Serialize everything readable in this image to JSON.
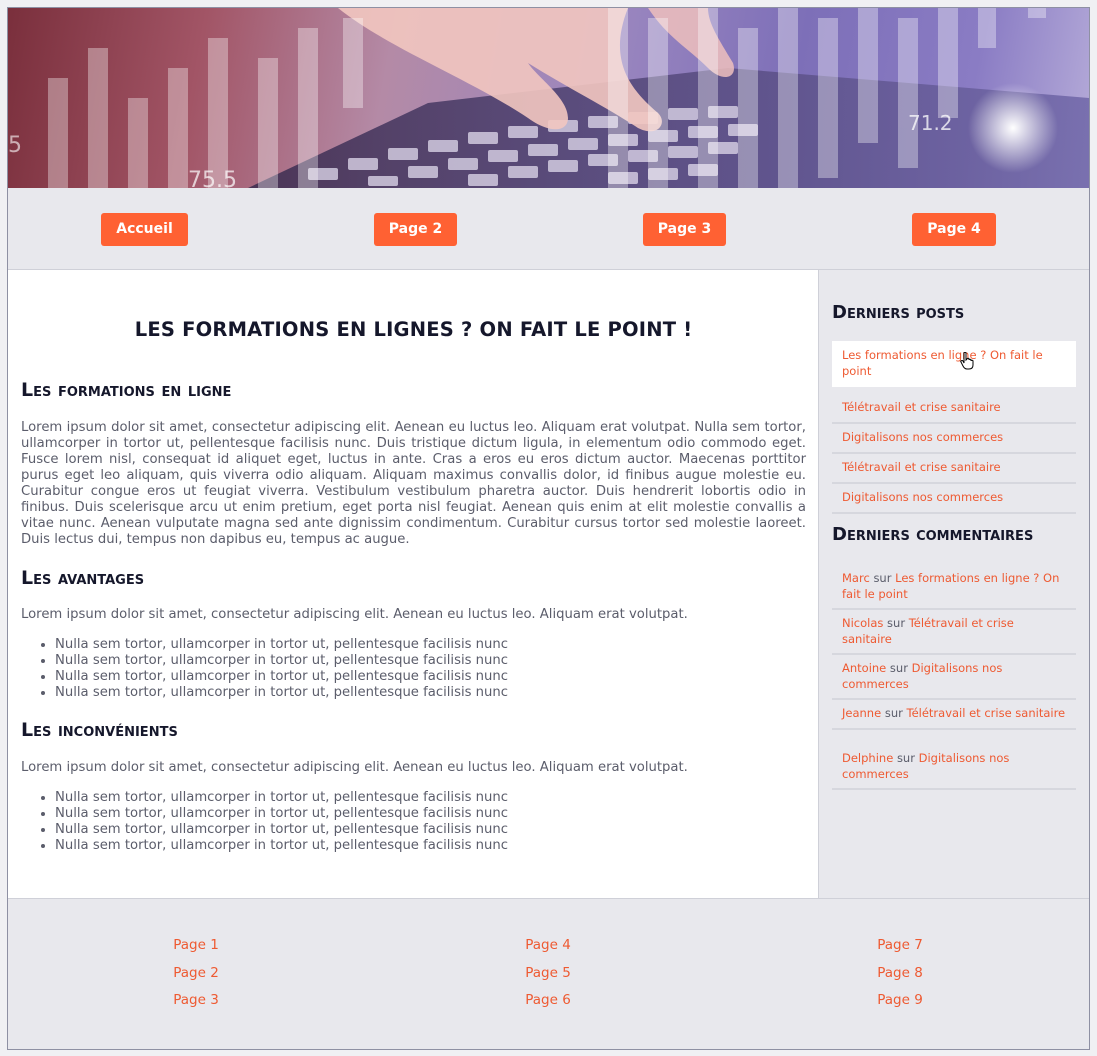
{
  "nav": {
    "items": [
      "Accueil",
      "Page 2",
      "Page 3",
      "Page 4"
    ]
  },
  "banner": {
    "numbers": [
      "75.5",
      "71.2",
      "5"
    ]
  },
  "article": {
    "title": "LES FORMATIONS EN LIGNES ? ON FAIT LE POINT !",
    "sections": [
      {
        "heading": "Les formations en ligne",
        "text": "Lorem ipsum dolor sit amet, consectetur adipiscing elit. Aenean eu luctus leo. Aliquam erat volutpat. Nulla sem tortor, ullamcorper in tortor ut, pellentesque facilisis nunc. Duis tristique dictum ligula, in elementum odio commodo eget. Fusce lorem nisl, consequat id aliquet eget, luctus in ante. Cras a eros eu eros dictum auctor. Maecenas porttitor purus eget leo aliquam, quis viverra odio aliquam. Aliquam maximus convallis dolor, id finibus augue molestie eu. Curabitur congue eros ut feugiat viverra. Vestibulum vestibulum pharetra auctor. Duis hendrerit lobortis odio in finibus. Duis scelerisque arcu ut enim pretium, eget porta nisl feugiat. Aenean quis enim at elit molestie convallis a vitae nunc. Aenean vulputate magna sed ante dignissim condimentum. Curabitur cursus tortor sed molestie laoreet. Duis lectus dui, tempus non dapibus eu, tempus ac augue."
      },
      {
        "heading": "Les avantages",
        "text": "Lorem ipsum dolor sit amet, consectetur adipiscing elit. Aenean eu luctus leo. Aliquam erat volutpat.",
        "bullets": [
          "Nulla sem tortor, ullamcorper in tortor ut, pellentesque facilisis nunc",
          "Nulla sem tortor, ullamcorper in tortor ut, pellentesque facilisis nunc",
          "Nulla sem tortor, ullamcorper in tortor ut, pellentesque facilisis nunc",
          "Nulla sem tortor, ullamcorper in tortor ut, pellentesque facilisis nunc"
        ]
      },
      {
        "heading": "Les inconvénients",
        "text": "Lorem ipsum dolor sit amet, consectetur adipiscing elit. Aenean eu luctus leo. Aliquam erat volutpat.",
        "bullets": [
          "Nulla sem tortor, ullamcorper in tortor ut, pellentesque facilisis nunc",
          "Nulla sem tortor, ullamcorper in tortor ut, pellentesque facilisis nunc",
          "Nulla sem tortor, ullamcorper in tortor ut, pellentesque facilisis nunc",
          "Nulla sem tortor, ullamcorper in tortor ut, pellentesque facilisis nunc"
        ]
      }
    ]
  },
  "sidebar": {
    "posts_title": "Derniers posts",
    "posts": [
      "Les formations en ligne ? On fait le point",
      "Télétravail et crise sanitaire",
      "Digitalisons nos commerces",
      "Télétravail et crise sanitaire",
      "Digitalisons nos commerces"
    ],
    "comments_title": "Derniers commentaires",
    "comments": [
      {
        "author": "Marc",
        "sep": "sur",
        "post": "Les formations en ligne ? On fait le point"
      },
      {
        "author": "Nicolas",
        "sep": "sur",
        "post": "Télétravail et crise sanitaire"
      },
      {
        "author": "Antoine",
        "sep": "sur",
        "post": "Digitalisons nos commerces"
      },
      {
        "author": "Jeanne",
        "sep": "sur",
        "post": "Télétravail et crise sanitaire"
      },
      {
        "author": "Delphine",
        "sep": "sur",
        "post": "Digitalisons nos commerces"
      }
    ]
  },
  "footer": {
    "links": [
      "Page 1",
      "Page 2",
      "Page 3",
      "Page 4",
      "Page 5",
      "Page 6",
      "Page 7",
      "Page 8",
      "Page 9"
    ]
  },
  "colors": {
    "accent": "#ff6133",
    "link": "#ee5a32",
    "heading": "#15172b",
    "body_text": "#5b5d6b",
    "panel": "#e8e8ed"
  }
}
